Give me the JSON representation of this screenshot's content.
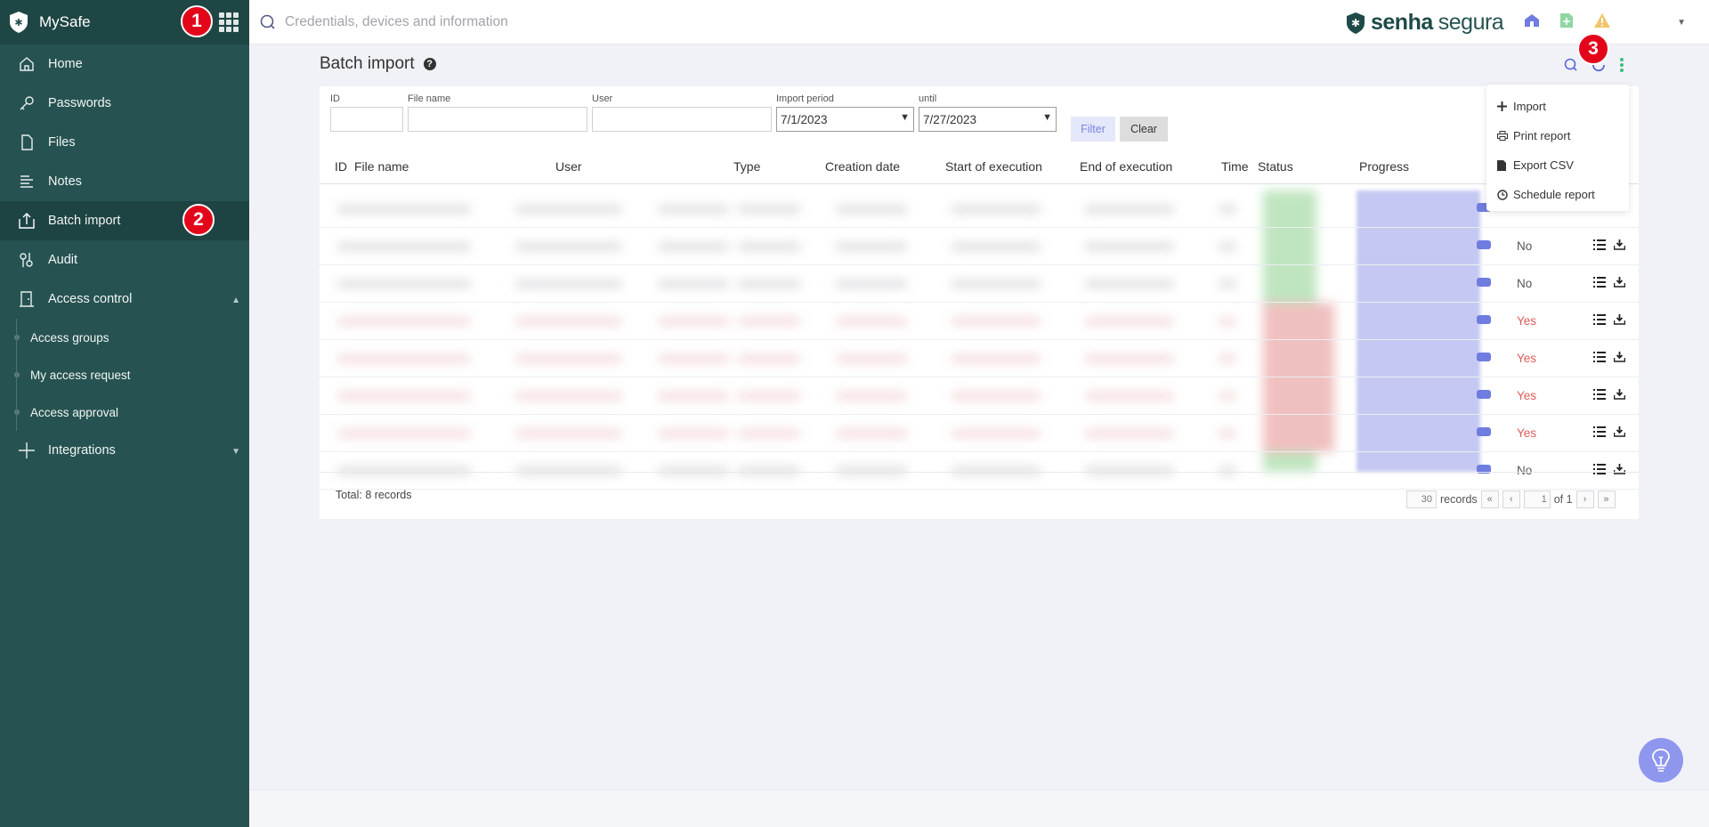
{
  "app": {
    "name": "MySafe"
  },
  "sidebar": {
    "items": [
      {
        "label": "Home",
        "icon": "home-icon"
      },
      {
        "label": "Passwords",
        "icon": "key-icon"
      },
      {
        "label": "Files",
        "icon": "file-icon"
      },
      {
        "label": "Notes",
        "icon": "notes-icon"
      },
      {
        "label": "Batch import",
        "icon": "upload-icon",
        "active": true
      },
      {
        "label": "Audit",
        "icon": "audit-icon"
      },
      {
        "label": "Access control",
        "icon": "door-icon",
        "expanded": true
      }
    ],
    "subitems": [
      "Access groups",
      "My access request",
      "Access approval"
    ],
    "integrations": {
      "label": "Integrations",
      "icon": "plus-icon"
    }
  },
  "search": {
    "placeholder": "Credentials, devices and information"
  },
  "brand": {
    "part1": "senha",
    "part2": "segura"
  },
  "page": {
    "title": "Batch import"
  },
  "filters": {
    "id_label": "ID",
    "file_label": "File name",
    "user_label": "User",
    "period_label": "Import period",
    "period_from": "7/1/2023",
    "until_label": "until",
    "period_to": "7/27/2023",
    "filter_button": "Filter",
    "clear_button": "Clear"
  },
  "table": {
    "columns": [
      "ID",
      "File name",
      "User",
      "Type",
      "Creation date",
      "Start of execution",
      "End of execution",
      "Time",
      "Status",
      "Progress"
    ],
    "rows": [
      {
        "flag": "",
        "status": "ok"
      },
      {
        "flag": "No",
        "status": "ok"
      },
      {
        "flag": "No",
        "status": "ok"
      },
      {
        "flag": "Yes",
        "status": "error"
      },
      {
        "flag": "Yes",
        "status": "error"
      },
      {
        "flag": "Yes",
        "status": "error"
      },
      {
        "flag": "Yes",
        "status": "error"
      },
      {
        "flag": "No",
        "status": "ok"
      }
    ]
  },
  "footer": {
    "total": "Total: 8 records",
    "per_page": "30",
    "records_label": "records",
    "page": "1",
    "of_label": "of 1"
  },
  "dropdown": {
    "items": [
      {
        "label": "Import",
        "icon": "plus-icon"
      },
      {
        "label": "Print report",
        "icon": "printer-icon"
      },
      {
        "label": "Export CSV",
        "icon": "csv-file-icon"
      },
      {
        "label": "Schedule report",
        "icon": "clock-icon"
      }
    ]
  },
  "badges": [
    "1",
    "2",
    "3"
  ],
  "colors": {
    "sidebar": "#265351",
    "accent": "#6f7ce0",
    "yes": "#e05a5a",
    "badge": "#e3061a"
  }
}
